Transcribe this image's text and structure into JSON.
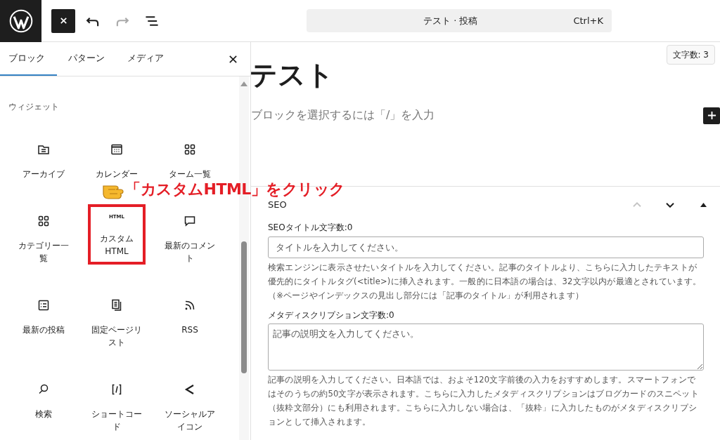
{
  "toolbar": {
    "buttons": [
      {
        "kind": "close",
        "active": true,
        "disabled": false
      },
      {
        "kind": "undo",
        "active": false,
        "disabled": false
      },
      {
        "kind": "redo",
        "active": false,
        "disabled": true
      },
      {
        "kind": "list_view",
        "active": false,
        "disabled": false
      }
    ]
  },
  "command_bar": {
    "title": "テスト · 投稿",
    "shortcut": "Ctrl+K"
  },
  "inserter": {
    "tabs": [
      {
        "label": "ブロック",
        "selected": true
      },
      {
        "label": "パターン",
        "selected": false
      },
      {
        "label": "メディア",
        "selected": false
      }
    ],
    "category": "ウィジェット",
    "blocks": [
      {
        "kind": "archive",
        "label": "アーカイブ",
        "highlighted": false
      },
      {
        "kind": "calendar",
        "label": "カレンダー",
        "highlighted": false
      },
      {
        "kind": "grid",
        "label": "ターム一覧",
        "highlighted": false
      },
      {
        "kind": "grid",
        "label": "カテゴリー一覧",
        "highlighted": false
      },
      {
        "kind": "html",
        "label": "カスタム HTML",
        "icon_text": "HTML",
        "highlighted": true
      },
      {
        "kind": "comment",
        "label": "最新のコメント",
        "highlighted": false
      },
      {
        "kind": "list",
        "label": "最新の投稿",
        "highlighted": false
      },
      {
        "kind": "pages",
        "label": "固定ページリスト",
        "highlighted": false
      },
      {
        "kind": "rss",
        "label": "RSS",
        "highlighted": false
      },
      {
        "kind": "search",
        "label": "検索",
        "highlighted": false
      },
      {
        "kind": "shortcode",
        "label": "ショートコード",
        "highlighted": false
      },
      {
        "kind": "share",
        "label": "ソーシャルアイコン",
        "highlighted": false
      }
    ]
  },
  "annotation": {
    "text": "「カスタムHTML」をクリック"
  },
  "editor": {
    "word_count": "文字数: 3",
    "title": "テスト",
    "placeholder": "ブロックを選択するには「/」を入力"
  },
  "seo_panel": {
    "title": "SEO",
    "controls": [
      {
        "kind": "up",
        "disabled": true
      },
      {
        "kind": "down",
        "disabled": false
      },
      {
        "kind": "toggle",
        "disabled": false
      }
    ],
    "fields": [
      {
        "kind": "input",
        "label": "SEOタイトル文字数:0",
        "placeholder": "タイトルを入力してください。",
        "help": "検索エンジンに表示させたいタイトルを入力してください。記事のタイトルより、こちらに入力したテキストが優先的にタイトルタグ(<title>)に挿入されます。一般的に日本語の場合は、32文字以内が最適とされています。（※ページやインデックスの見出し部分には「記事のタイトル」が利用されます）"
      },
      {
        "kind": "textarea",
        "label": "メタディスクリプション文字数:0",
        "placeholder": "記事の説明文を入力してください。",
        "help": "記事の説明を入力してください。日本語では、およそ120文字前後の入力をおすすめします。スマートフォンではそのうちの約50文字が表示されます。こちらに入力したメタディスクリプションはブログカードのスニペット（抜粋文部分）にも利用されます。こちらに入力しない場合は、「抜粋」に入力したものがメタディスクリプションとして挿入されます。"
      }
    ]
  }
}
